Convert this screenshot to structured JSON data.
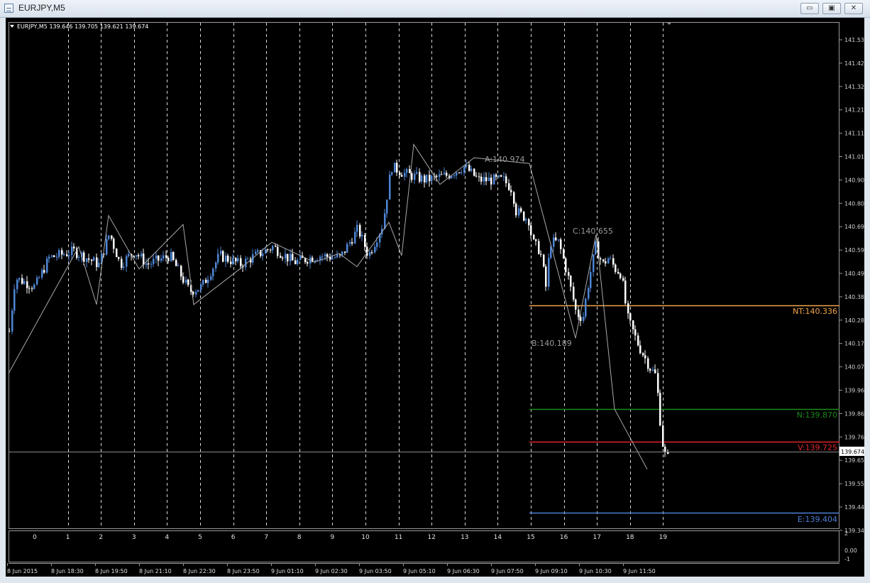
{
  "window": {
    "title": "EURJPY,M5",
    "buttons": [
      "minimize",
      "maximize",
      "close"
    ]
  },
  "chart": {
    "header": "EURJPY,M5  139.646 139.705 139.621 139.674",
    "current_price_label": "139.674",
    "colors": {
      "background": "#000000",
      "bull_candle": "#4f86d6",
      "bear_candle": "#ffffff",
      "zigzag": "#a8a8a8",
      "nt_line": "#f2a54a",
      "n_line": "#1d8a1d",
      "v_line": "#e0252f",
      "e_line": "#4d7fd6"
    },
    "price_ticks": [
      "141.530",
      "141.425",
      "141.320",
      "141.215",
      "141.115",
      "141.010",
      "140.905",
      "140.800",
      "140.695",
      "140.590",
      "140.490",
      "140.385",
      "140.280",
      "140.175",
      "140.070",
      "139.965",
      "139.860",
      "139.760",
      "139.655",
      "139.550",
      "139.445",
      "139.340"
    ],
    "grid_numbers": [
      "0",
      "1",
      "2",
      "3",
      "4",
      "5",
      "6",
      "7",
      "8",
      "9",
      "10",
      "11",
      "12",
      "13",
      "14",
      "15",
      "16",
      "17",
      "18",
      "19"
    ],
    "time_labels": [
      "8 Jun 2015",
      "8 Jun 18:30",
      "8 Jun 19:50",
      "8 Jun 21:10",
      "8 Jun 22:30",
      "8 Jun 23:50",
      "9 Jun 01:10",
      "9 Jun 02:30",
      "9 Jun 03:50",
      "9 Jun 05:10",
      "9 Jun 06:30",
      "9 Jun 07:50",
      "9 Jun 09:10",
      "9 Jun 10:30",
      "9 Jun 11:50"
    ],
    "indicator_ticks": [
      "2",
      "0.00",
      "-1"
    ],
    "annotations": {
      "a": "A:140.974",
      "b": "B:140.189",
      "c": "C:140.655"
    },
    "levels": [
      {
        "key": "nt",
        "label": "NT:140.336",
        "price": 140.336,
        "color": "#f2a54a"
      },
      {
        "key": "n",
        "label": "N:139.870",
        "price": 139.87,
        "color": "#1d8a1d"
      },
      {
        "key": "v",
        "label": "V:139.725",
        "price": 139.725,
        "color": "#e0252f"
      },
      {
        "key": "e",
        "label": "E:139.404",
        "price": 139.404,
        "color": "#4d7fd6"
      }
    ],
    "zigzag_prices": [
      140.03,
      140.6,
      140.34,
      140.74,
      140.5,
      140.7,
      140.34,
      140.5,
      140.62,
      140.53,
      140.57,
      140.51,
      140.71,
      140.56,
      141.06,
      140.88,
      141.0,
      140.974,
      140.189,
      140.655,
      139.87,
      139.6
    ]
  }
}
